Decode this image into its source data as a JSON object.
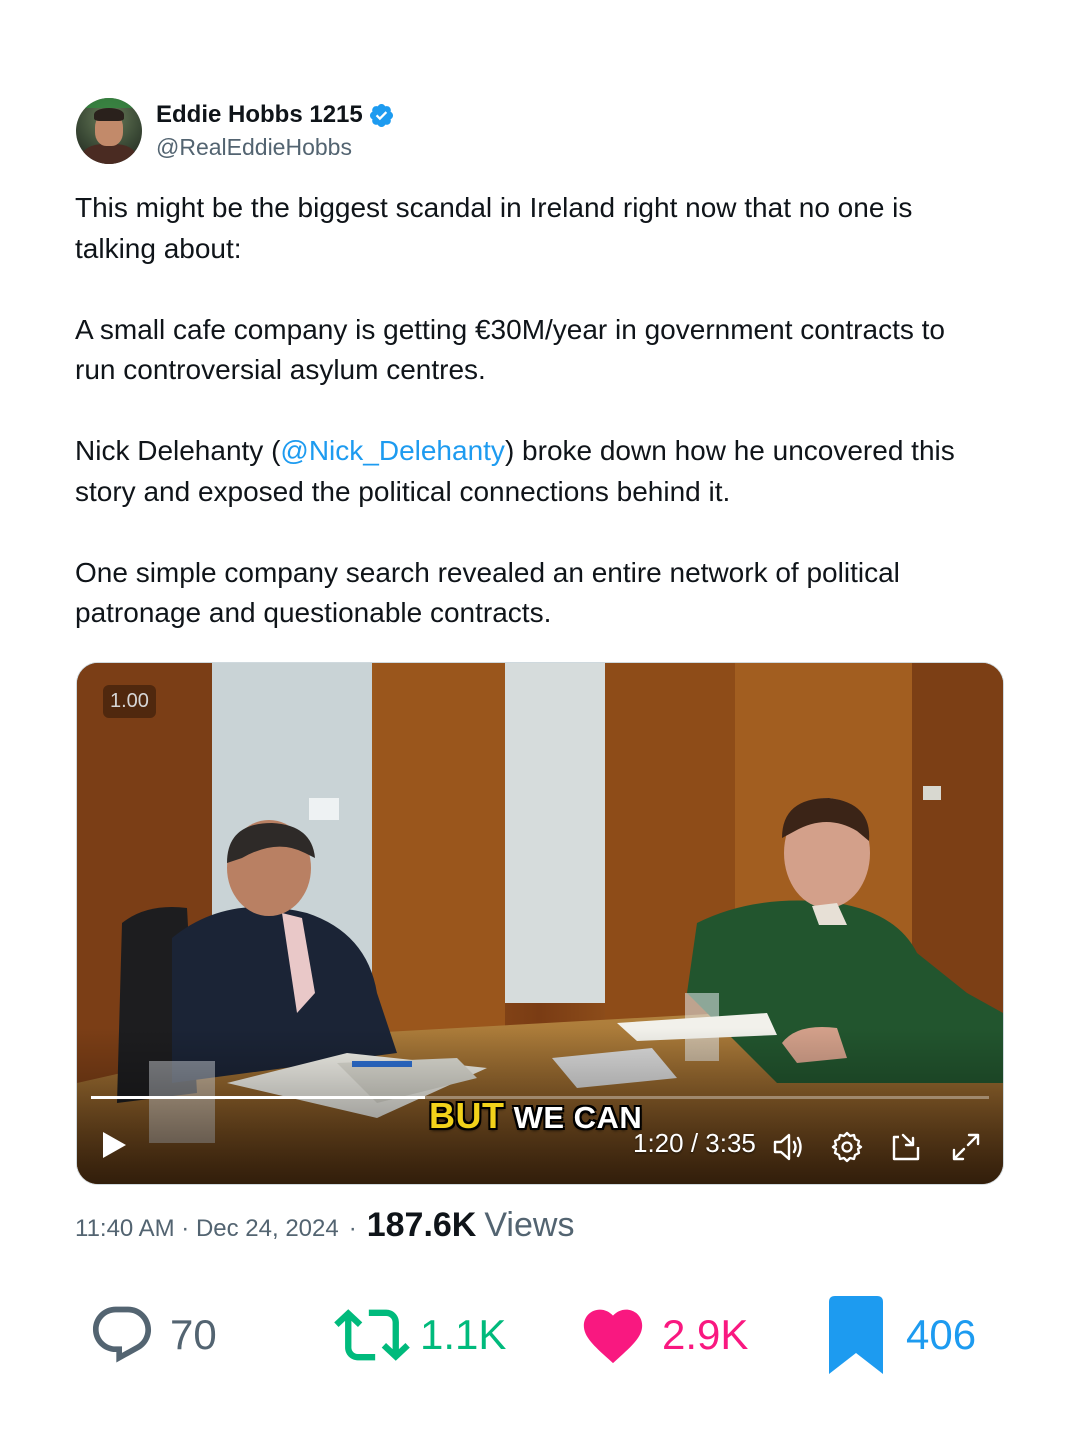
{
  "author": {
    "display_name": "Eddie Hobbs 1215",
    "handle": "@RealEddieHobbs",
    "verified": true,
    "verified_color": "#1d9bf0"
  },
  "tweet": {
    "p1_l1": "This might be the biggest scandal in Ireland right now that no one is",
    "p1_l2": "talking about:",
    "p2_l1": "A small cafe company is getting €30M/year in government contracts to",
    "p2_l2": "run controversial asylum centres.",
    "p3_l1_a": "Nick Delehanty (",
    "p3_mention": "@Nick_Delehanty",
    "p3_l1_b": ") broke down how he uncovered this",
    "p3_l2": "story and exposed the political connections behind it.",
    "p4_l1": "One simple company search revealed an entire network of political",
    "p4_l2": "patronage and questionable contracts."
  },
  "video": {
    "speed_badge": "1.00",
    "caption_highlight": "BUT",
    "caption_rest": " WE CAN",
    "time": "1:20 / 3:35",
    "progress_fraction": 0.372,
    "icons": [
      "play-icon",
      "volume-icon",
      "settings-icon",
      "dock-icon",
      "fullscreen-icon"
    ]
  },
  "meta": {
    "timestamp": "11:40 AM · Dec 24, 2024",
    "separator": "·",
    "views_count": "187.6K",
    "views_label": "Views"
  },
  "actions": {
    "replies": "70",
    "reposts": "1.1K",
    "likes": "2.9K",
    "bookmarks": "406",
    "colors": {
      "reply": "#536471",
      "repost": "#00ba7c",
      "like": "#f91880",
      "bookmark": "#1d9bf0"
    }
  }
}
